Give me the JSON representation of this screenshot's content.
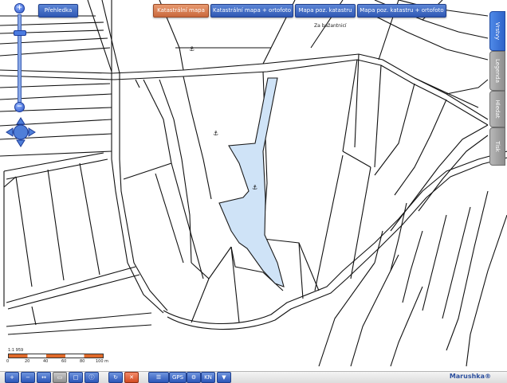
{
  "top_buttons": {
    "overview": "Přehledka",
    "katastralni_mapa": "Katastrální mapa",
    "katastralni_ortofoto": "Katastrální mapa + ortofoto",
    "mapa_poz_katastru": "Mapa poz. katastru",
    "mapa_poz_ortofoto": "Mapa poz. katastru + ortofoto"
  },
  "side_tabs": {
    "vrstvy": "Vrstvy",
    "legenda": "Legenda",
    "hledat": "Hledat",
    "tisk": "Tisk"
  },
  "zoom": {
    "plus": "+",
    "minus": "−"
  },
  "map": {
    "place_name": "Za bažantnicí"
  },
  "scale": {
    "ratio": "1:1 959",
    "ticks": [
      "0",
      "20",
      "40",
      "60",
      "80",
      "100 m"
    ]
  },
  "toolbar": {
    "gps_label": "GPS",
    "kn_label": "KN"
  },
  "brand": {
    "logo": "Marushka®"
  },
  "colors": {
    "highlight_fill": "#cfe3f7",
    "highlight_stroke": "#1a1a1a",
    "accent_blue": "#2f58b4",
    "active_orange": "#c9683c"
  }
}
